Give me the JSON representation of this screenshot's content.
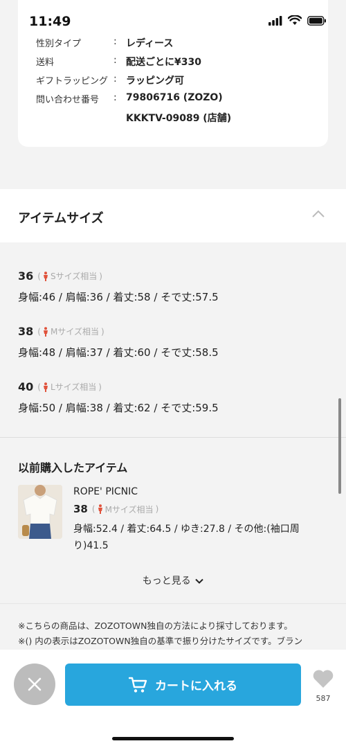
{
  "status_bar": {
    "time": "11:49"
  },
  "item_info": {
    "rows": [
      {
        "key": "性別タイプ",
        "sep": ":",
        "value": "レディース"
      },
      {
        "key": "送料",
        "sep": ":",
        "value": "配送ごとに¥330"
      },
      {
        "key": "ギフトラッピング",
        "sep": ":",
        "value": "ラッピング可"
      },
      {
        "key": "問い合わせ番号",
        "sep": ":",
        "value": "79806716 (ZOZO)"
      },
      {
        "key": "",
        "sep": "",
        "value": "KKKTV-09089 (店舗)"
      }
    ]
  },
  "item_size": {
    "title": "アイテムサイズ",
    "sizes": [
      {
        "size": "36",
        "hint": "Sサイズ相当",
        "measurements": "身幅:46 / 肩幅:36 / 着丈:58 / そで丈:57.5"
      },
      {
        "size": "38",
        "hint": "Mサイズ相当",
        "measurements": "身幅:48 / 肩幅:37 / 着丈:60 / そで丈:58.5"
      },
      {
        "size": "40",
        "hint": "Lサイズ相当",
        "measurements": "身幅:50 / 肩幅:38 / 着丈:62 / そで丈:59.5"
      }
    ]
  },
  "previous": {
    "title": "以前購入したアイテム",
    "brand": "ROPE' PICNIC",
    "size": "38",
    "hint": "Mサイズ相当",
    "measurements": "身幅:52.4 / 着丈:64.5 / ゆき:27.8 / その他:(袖口周り)41.5"
  },
  "more_label": "もっと見る",
  "notes": [
    "※こちらの商品は、ZOZOTOWN独自の方法により採寸しております。",
    "※() 内の表示はZOZOTOWN独自の基準で振り分けたサイズです。ブラン"
  ],
  "bottom_bar": {
    "cart_label": "カートに入れる",
    "favorite_count": "587"
  },
  "colors": {
    "accent": "#28a6dd",
    "close": "#bcbcbc",
    "hint": "#aaaaaa",
    "pin": "#e0533c"
  }
}
